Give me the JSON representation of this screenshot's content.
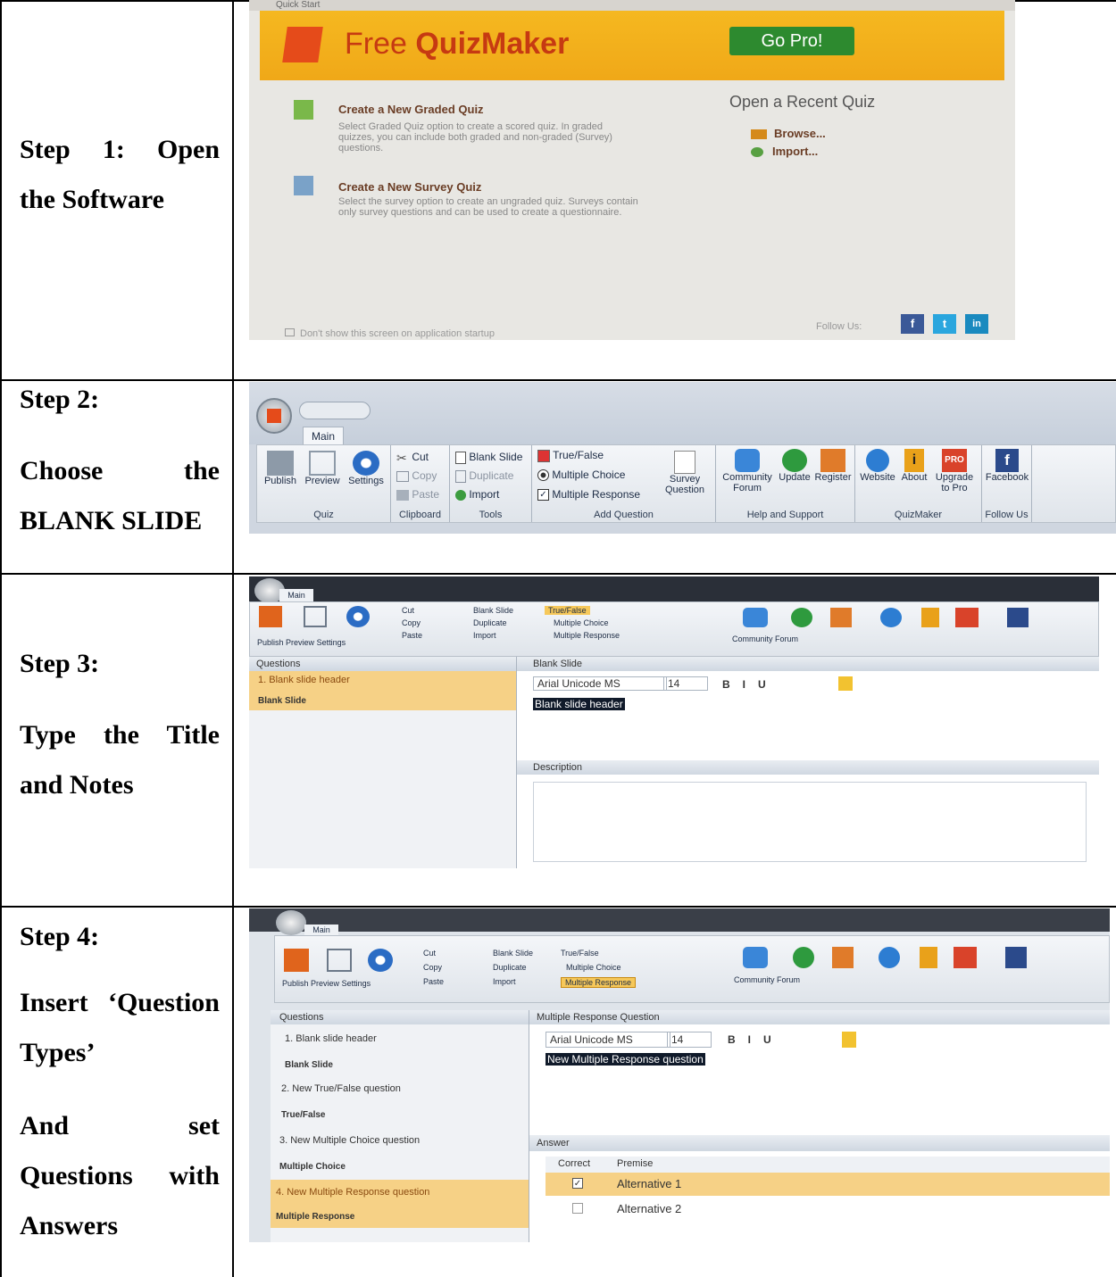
{
  "rows": [
    {
      "label_a": "Step 1: Open",
      "label_b": "the Software"
    },
    {
      "label_title": "Step 2:",
      "label_a": "Choose the",
      "label_b": "BLANK SLIDE"
    },
    {
      "label_title": "Step 3:",
      "label_a": "Type the Title",
      "label_b": "and Notes"
    },
    {
      "label_title": "Step 4:",
      "label_a": "Insert ‘Question",
      "label_b": "Types’",
      "label_c": "And set",
      "label_d": "Questions with",
      "label_e": "Answers"
    }
  ],
  "quickstart": {
    "window_title": "Quick Start",
    "app_name_a": "Free ",
    "app_name_b": "QuizMaker",
    "go_pro": "Go Pro!",
    "graded_title": "Create a New Graded Quiz",
    "graded_desc": "Select Graded Quiz option to create a scored quiz. In graded quizzes, you can include both graded and non-graded (Survey) questions.",
    "survey_title": "Create a New Survey Quiz",
    "survey_desc": "Select the survey option to create an ungraded quiz. Surveys contain only survey questions and can be used to create a questionnaire.",
    "recent_title": "Open a Recent Quiz",
    "browse": "Browse...",
    "import": "Import...",
    "dont_show": "Don't show this screen on application startup",
    "follow_us": "Follow Us:",
    "social": [
      "f",
      "t",
      "in"
    ]
  },
  "ribbon": {
    "tab": "Main",
    "publish": "Publish",
    "preview": "Preview",
    "settings": "Settings",
    "quiz": "Quiz",
    "cut": "Cut",
    "copy": "Copy",
    "paste": "Paste",
    "clipboard": "Clipboard",
    "blank_slide": "Blank Slide",
    "duplicate": "Duplicate",
    "import": "Import",
    "tools": "Tools",
    "true_false": "True/False",
    "multiple_choice": "Multiple Choice",
    "multiple_response": "Multiple Response",
    "survey_question": "Survey Question",
    "add_question": "Add Question",
    "community_forum": "Community Forum",
    "update": "Update",
    "register": "Register",
    "help_support": "Help and Support",
    "website": "Website",
    "about": "About",
    "upgrade_pro": "Upgrade to Pro",
    "quizmaker": "QuizMaker",
    "facebook": "Facebook",
    "follow_us": "Follow Us",
    "pro_badge": "PRO"
  },
  "editor3": {
    "questions_header": "Questions",
    "q1": "1. Blank slide header",
    "q1_type": "Blank Slide",
    "slide_header": "Blank Slide",
    "font": "Arial Unicode MS",
    "size": "14",
    "text": "Blank slide header",
    "description": "Description"
  },
  "editor4": {
    "questions_header": "Questions",
    "q1": "1. Blank slide header",
    "q1_type": "Blank Slide",
    "q2": "2. New True/False question",
    "q2_type": "True/False",
    "q3": "3. New Multiple Choice question",
    "q3_type": "Multiple Choice",
    "q4": "4. New Multiple Response question",
    "q4_type": "Multiple Response",
    "slide_header": "Multiple Response Question",
    "font": "Arial Unicode MS",
    "size": "14",
    "text": "New Multiple Response question",
    "answer": "Answer",
    "correct": "Correct",
    "premise": "Premise",
    "alt1": "Alternative 1",
    "alt2": "Alternative 2"
  }
}
